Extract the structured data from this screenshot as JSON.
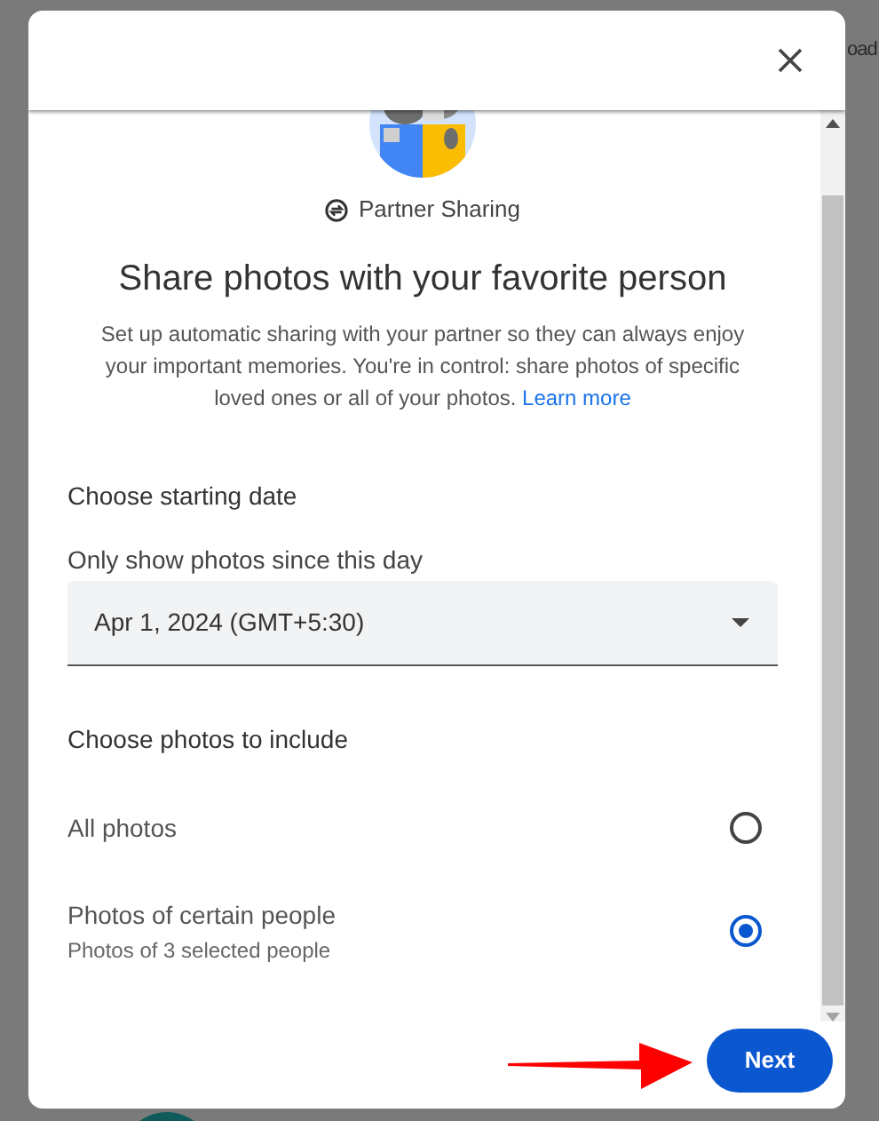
{
  "background": {
    "text": "oad"
  },
  "dialog": {
    "badge": "Partner Sharing",
    "title": "Share photos with your favorite person",
    "description": "Set up automatic sharing with your partner so they can always enjoy your important memories. You're in control: share photos of specific loved ones or all of your photos.",
    "learn_more": "Learn more",
    "date_section": {
      "heading": "Choose starting date",
      "label": "Only show photos since this day",
      "value": "Apr 1, 2024 (GMT+5:30)"
    },
    "photos_section": {
      "heading": "Choose photos to include",
      "options": [
        {
          "label": "All photos",
          "selected": false
        },
        {
          "label": "Photos of certain people",
          "sublabel": "Photos of 3 selected people",
          "selected": true
        }
      ]
    },
    "next_button": "Next"
  }
}
